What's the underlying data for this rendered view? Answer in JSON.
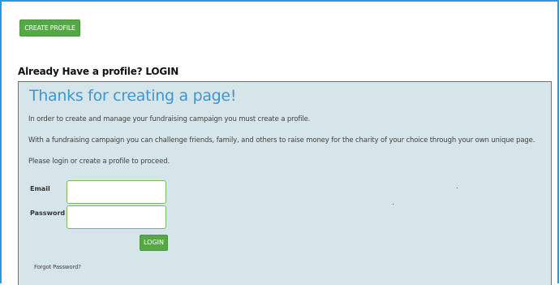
{
  "toolbar": {
    "create_profile_label": "CREATE PROFILE"
  },
  "login_section": {
    "heading": "Already Have a profile? LOGIN",
    "panel_title": "Thanks for creating a page!",
    "paragraphs": [
      "In order to create and manage your fundraising campaign you must create a profile.",
      "With a fundraising campaign you can challenge friends, family, and others to raise money for the charity of your choice through your own unique page.",
      "Please login or create a profile to proceed."
    ],
    "email_label": "Email",
    "email_value": "",
    "password_label": "Password",
    "password_value": "",
    "login_button": "LOGIN",
    "forgot_password": "Forgot Password?"
  },
  "colors": {
    "frame_border": "#2c9ad8",
    "button_green": "#55a846",
    "panel_bg": "#d6e5ea",
    "title_blue": "#3d97cf",
    "input_border": "#7bbb5f"
  }
}
